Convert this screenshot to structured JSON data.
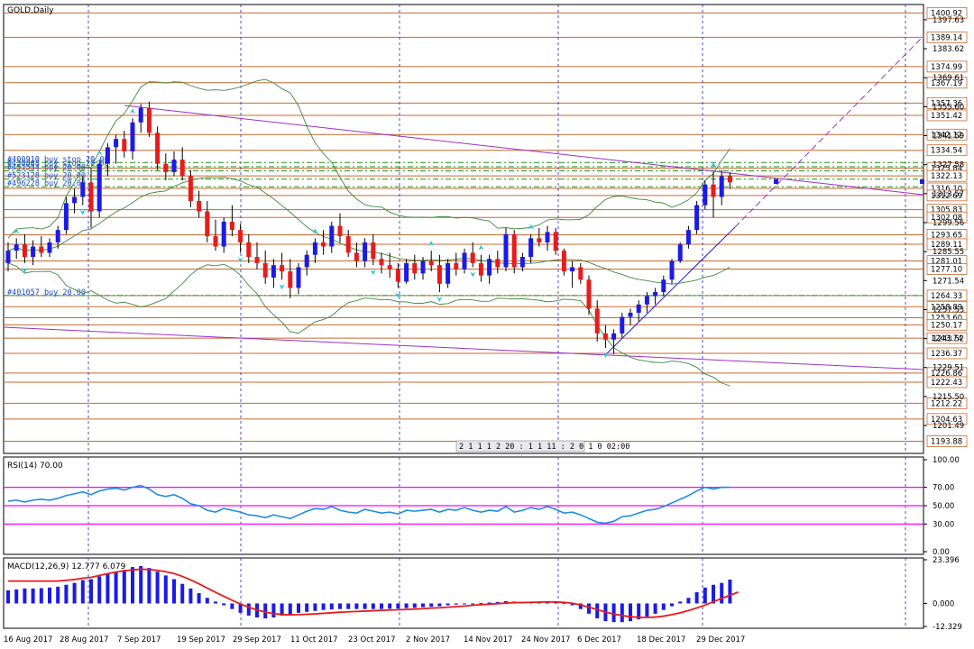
{
  "window": {
    "title": "GOLD,Daily"
  },
  "colors": {
    "bull": "#1b1be8",
    "bear": "#e81b1b",
    "grid": "#2222cc",
    "hline": "#c8692f",
    "trend": "#9b30c8",
    "band": "#3c8a3c",
    "order": "#3aa03a",
    "rsi": "#1f8ce0",
    "rsi_level": "#ff00ff",
    "macd_hist": "#1b1be8",
    "macd_signal": "#e81b1b",
    "fractal": "#29c7e0"
  },
  "price_axis": {
    "ticks": [
      "1397.63",
      "1383.62",
      "1369.61",
      "1355.60",
      "1341.59",
      "1327.58",
      "1313.57",
      "1299.56",
      "1285.55",
      "1271.54",
      "1257.53",
      "1243.52",
      "1229.51",
      "1215.50",
      "1201.49"
    ],
    "levels": [
      "1400.92",
      "1389.14",
      "1374.99",
      "1367.19",
      "1357.36",
      "1351.42",
      "1342.12",
      "1334.54",
      "1325.84",
      "1322.13",
      "1316.10",
      "1312.69",
      "1305.83",
      "1302.08",
      "1293.65",
      "1289.11",
      "1281.01",
      "1277.10",
      "1264.33",
      "1258.89",
      "1253.60",
      "1250.17",
      "1243.74",
      "1236.37",
      "1226.86",
      "1222.43",
      "1212.22",
      "1204.63",
      "1193.88"
    ],
    "range": [
      1188,
      1405
    ]
  },
  "orders": [
    {
      "text": "#400910 buy stop 20.00",
      "price": 1328.6
    },
    {
      "text": "#438888 buy stop 20.00",
      "price": 1326.6
    },
    {
      "text": "#451534 buy 20.00",
      "price": 1324.6
    },
    {
      "text": "#523128 buy 20.00",
      "price": 1320.6
    },
    {
      "text": "#496228 buy 20.00",
      "price": 1316.9
    },
    {
      "text": "#401057 buy 20.00",
      "price": 1264.3
    }
  ],
  "clock": "2 1 1 1 2 20 : 1 1 11 : 2 0 1 0 02:00",
  "date_labels": [
    "16 Aug 2017",
    "28 Aug 2017",
    "7 Sep 2017",
    "19 Sep 2017",
    "29 Sep 2017",
    "11 Oct 2017",
    "23 Oct 2017",
    "2 Nov 2017",
    "14 Nov 2017",
    "24 Nov 2017",
    "6 Dec 2017",
    "18 Dec 2017",
    "29 Dec 2017"
  ],
  "rsi": {
    "label": "RSI(14) 70.00",
    "ticks": [
      "100.00",
      "70.00",
      "50.00",
      "30.00",
      "0.00"
    ],
    "levels": [
      70,
      50,
      30
    ]
  },
  "macd": {
    "label": "MACD(12,26,9) 12.777 6.079",
    "ticks": [
      "23.396",
      "0.000",
      "-12.329"
    ],
    "range": [
      -12.329,
      23.396
    ]
  },
  "chart_data": {
    "type": "candlestick",
    "title": "GOLD,Daily",
    "candles": [
      [
        1280,
        1290,
        1276,
        1286
      ],
      [
        1286,
        1292,
        1282,
        1289
      ],
      [
        1289,
        1294,
        1280,
        1283
      ],
      [
        1283,
        1291,
        1279,
        1288
      ],
      [
        1288,
        1293,
        1283,
        1285
      ],
      [
        1285,
        1292,
        1283,
        1290
      ],
      [
        1290,
        1298,
        1287,
        1296
      ],
      [
        1296,
        1312,
        1294,
        1309
      ],
      [
        1309,
        1316,
        1304,
        1312
      ],
      [
        1312,
        1322,
        1308,
        1319
      ],
      [
        1319,
        1326,
        1297,
        1305
      ],
      [
        1305,
        1330,
        1302,
        1328
      ],
      [
        1328,
        1338,
        1322,
        1336
      ],
      [
        1336,
        1342,
        1328,
        1340
      ],
      [
        1340,
        1344,
        1331,
        1334
      ],
      [
        1334,
        1350,
        1330,
        1348
      ],
      [
        1348,
        1357,
        1343,
        1355
      ],
      [
        1355,
        1358,
        1341,
        1343
      ],
      [
        1343,
        1346,
        1325,
        1328
      ],
      [
        1328,
        1333,
        1320,
        1324
      ],
      [
        1324,
        1334,
        1322,
        1330
      ],
      [
        1330,
        1336,
        1320,
        1322
      ],
      [
        1322,
        1325,
        1307,
        1310
      ],
      [
        1310,
        1315,
        1302,
        1305
      ],
      [
        1305,
        1310,
        1290,
        1293
      ],
      [
        1293,
        1301,
        1286,
        1288
      ],
      [
        1288,
        1302,
        1285,
        1300
      ],
      [
        1300,
        1308,
        1293,
        1296
      ],
      [
        1296,
        1299,
        1285,
        1290
      ],
      [
        1290,
        1294,
        1280,
        1283
      ],
      [
        1283,
        1290,
        1277,
        1280
      ],
      [
        1280,
        1286,
        1270,
        1273
      ],
      [
        1273,
        1282,
        1268,
        1279
      ],
      [
        1279,
        1285,
        1272,
        1276
      ],
      [
        1276,
        1282,
        1263,
        1268
      ],
      [
        1268,
        1280,
        1265,
        1278
      ],
      [
        1278,
        1286,
        1274,
        1284
      ],
      [
        1284,
        1292,
        1280,
        1290
      ],
      [
        1290,
        1296,
        1284,
        1288
      ],
      [
        1288,
        1300,
        1285,
        1298
      ],
      [
        1298,
        1304,
        1290,
        1293
      ],
      [
        1293,
        1296,
        1283,
        1285
      ],
      [
        1285,
        1290,
        1278,
        1281
      ],
      [
        1281,
        1292,
        1278,
        1290
      ],
      [
        1290,
        1294,
        1279,
        1282
      ],
      [
        1282,
        1285,
        1275,
        1279
      ],
      [
        1279,
        1285,
        1273,
        1277
      ],
      [
        1277,
        1280,
        1268,
        1271
      ],
      [
        1271,
        1282,
        1270,
        1280
      ],
      [
        1280,
        1284,
        1272,
        1275
      ],
      [
        1275,
        1283,
        1272,
        1281
      ],
      [
        1281,
        1286,
        1276,
        1279
      ],
      [
        1279,
        1284,
        1266,
        1270
      ],
      [
        1270,
        1282,
        1268,
        1280
      ],
      [
        1280,
        1285,
        1274,
        1277
      ],
      [
        1277,
        1287,
        1275,
        1285
      ],
      [
        1285,
        1290,
        1278,
        1280
      ],
      [
        1280,
        1284,
        1271,
        1274
      ],
      [
        1274,
        1284,
        1270,
        1282
      ],
      [
        1282,
        1286,
        1275,
        1278
      ],
      [
        1278,
        1297,
        1276,
        1294
      ],
      [
        1294,
        1296,
        1275,
        1278
      ],
      [
        1278,
        1285,
        1276,
        1283
      ],
      [
        1283,
        1294,
        1280,
        1292
      ],
      [
        1292,
        1297,
        1288,
        1290
      ],
      [
        1290,
        1298,
        1286,
        1295
      ],
      [
        1295,
        1297,
        1284,
        1286
      ],
      [
        1286,
        1287,
        1274,
        1276
      ],
      [
        1276,
        1281,
        1268,
        1278
      ],
      [
        1278,
        1280,
        1270,
        1272
      ],
      [
        1272,
        1274,
        1255,
        1258
      ],
      [
        1258,
        1262,
        1242,
        1246
      ],
      [
        1246,
        1250,
        1239,
        1243
      ],
      [
        1243,
        1248,
        1236,
        1246
      ],
      [
        1246,
        1256,
        1244,
        1254
      ],
      [
        1254,
        1258,
        1250,
        1256
      ],
      [
        1256,
        1262,
        1252,
        1260
      ],
      [
        1260,
        1266,
        1256,
        1264
      ],
      [
        1264,
        1268,
        1260,
        1266
      ],
      [
        1266,
        1274,
        1264,
        1272
      ],
      [
        1272,
        1282,
        1270,
        1281
      ],
      [
        1281,
        1290,
        1280,
        1289
      ],
      [
        1289,
        1298,
        1287,
        1296
      ],
      [
        1296,
        1310,
        1294,
        1308
      ],
      [
        1308,
        1320,
        1306,
        1318
      ],
      [
        1318,
        1324,
        1302,
        1312
      ],
      [
        1312,
        1325,
        1308,
        1322
      ],
      [
        1322,
        1324,
        1316,
        1319
      ]
    ],
    "rsi": [
      55,
      56,
      54,
      56,
      57,
      56,
      58,
      61,
      63,
      65,
      62,
      66,
      68,
      69,
      67,
      70,
      72,
      68,
      62,
      60,
      62,
      58,
      52,
      50,
      45,
      43,
      47,
      45,
      43,
      40,
      39,
      37,
      40,
      38,
      36,
      40,
      44,
      47,
      46,
      49,
      45,
      43,
      42,
      46,
      44,
      42,
      43,
      41,
      45,
      44,
      45,
      46,
      43,
      46,
      45,
      48,
      45,
      43,
      45,
      44,
      49,
      43,
      45,
      48,
      46,
      49,
      46,
      42,
      43,
      40,
      36,
      32,
      31,
      33,
      38,
      39,
      42,
      45,
      46,
      49,
      53,
      57,
      61,
      66,
      70,
      68,
      70,
      70
    ],
    "macd_hist": [
      7,
      7.5,
      8,
      8,
      8.2,
      8.5,
      9,
      10,
      11,
      12.5,
      13,
      14.5,
      16,
      17,
      18,
      19.5,
      20,
      19,
      17,
      15,
      13,
      10.5,
      8,
      5.5,
      3,
      1,
      -1,
      -3,
      -5,
      -6.5,
      -7.5,
      -8,
      -7.5,
      -6.5,
      -6,
      -5,
      -4.5,
      -4,
      -3.5,
      -3.2,
      -3,
      -3,
      -3,
      -3,
      -3,
      -3,
      -2.8,
      -2.8,
      -2.5,
      -2.3,
      -2,
      -1.8,
      -1.5,
      -1,
      -0.6,
      -0.3,
      0,
      0.3,
      0.5,
      0.8,
      1.2,
      1,
      0.8,
      0.8,
      1,
      1.2,
      1,
      0.3,
      -1,
      -3,
      -5.5,
      -8,
      -9.5,
      -10,
      -10,
      -9.5,
      -8.5,
      -7,
      -5.5,
      -3.5,
      -1.5,
      1,
      3,
      6,
      8.5,
      10,
      11,
      12.777
    ],
    "macd_signal": [
      12,
      12,
      12,
      12,
      12,
      12,
      12,
      12.4,
      12.8,
      13.5,
      14,
      15,
      16,
      16.8,
      17.5,
      18,
      18.3,
      18.2,
      17.7,
      17,
      16,
      14.5,
      12.6,
      10.5,
      8.2,
      6,
      3.8,
      1.7,
      -0.3,
      -2,
      -3.5,
      -4.6,
      -5.5,
      -5.9,
      -6.1,
      -6,
      -5.8,
      -5.6,
      -5.3,
      -5,
      -4.7,
      -4.5,
      -4.3,
      -4.1,
      -3.9,
      -3.7,
      -3.5,
      -3.4,
      -3.2,
      -3,
      -2.8,
      -2.5,
      -2.3,
      -2,
      -1.7,
      -1.4,
      -1,
      -0.7,
      -0.4,
      -0.1,
      0.2,
      0.4,
      0.5,
      0.6,
      0.7,
      0.8,
      0.8,
      0.6,
      0.1,
      -0.8,
      -2,
      -3.3,
      -4.6,
      -5.7,
      -6.5,
      -7.1,
      -7.4,
      -7.5,
      -7.3,
      -6.8,
      -6,
      -5,
      -3.8,
      -2.4,
      -0.9,
      0.9,
      2.7,
      4.4,
      6.079
    ]
  }
}
